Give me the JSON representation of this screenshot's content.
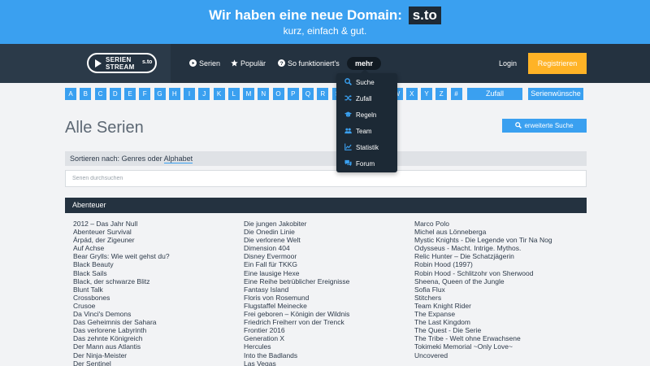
{
  "banner": {
    "main_text": "Wir haben eine neue Domain:",
    "domain": "s.to",
    "subtitle": "kurz, einfach & gut."
  },
  "logo": {
    "line1": "SERIEN",
    "line2": "STREAM",
    "badge": "s.to"
  },
  "nav": {
    "items": [
      {
        "label": "Serien",
        "icon": "play-circle-icon"
      },
      {
        "label": "Populär",
        "icon": "star-icon"
      },
      {
        "label": "So funktioniert's",
        "icon": "question-circle-icon"
      }
    ],
    "mehr_label": "mehr",
    "login_label": "Login",
    "register_label": "Registrieren"
  },
  "dropdown": {
    "items": [
      {
        "label": "Suche",
        "icon": "search-icon"
      },
      {
        "label": "Zufall",
        "icon": "shuffle-icon"
      },
      {
        "label": "Regeln",
        "icon": "graduation-cap-icon"
      },
      {
        "label": "Team",
        "icon": "users-icon"
      },
      {
        "label": "Statistik",
        "icon": "chart-icon"
      },
      {
        "label": "Forum",
        "icon": "comments-icon"
      }
    ]
  },
  "alphabet": [
    "A",
    "B",
    "C",
    "D",
    "E",
    "F",
    "G",
    "H",
    "I",
    "J",
    "K",
    "L",
    "M",
    "N",
    "O",
    "P",
    "Q",
    "R",
    "S",
    "T",
    "U",
    "V",
    "W",
    "X",
    "Y",
    "Z",
    "#"
  ],
  "buttons": {
    "zufall": "Zufall",
    "wuensche": "Serienwünsche",
    "extended_search": "erweiterte Suche"
  },
  "page": {
    "title": "Alle Serien"
  },
  "sort": {
    "prefix": "Sortieren nach:",
    "genres": "Genres",
    "oder": "oder",
    "alphabet": "Alphabet"
  },
  "search": {
    "placeholder": "Serien durchsuchen"
  },
  "genre": {
    "name": "Abenteuer",
    "columns": [
      [
        "2012 – Das Jahr Null",
        "Abenteuer Survival",
        "Árpád, der Zigeuner",
        "Auf Achse",
        "Bear Grylls: Wie weit gehst du?",
        "Black Beauty",
        "Black Sails",
        "Black, der schwarze Blitz",
        "Blunt Talk",
        "Crossbones",
        "Crusoe",
        "Da Vinci's Demons",
        "Das Geheimnis der Sahara",
        "Das verlorene Labyrinth",
        "Das zehnte Königreich",
        "Der Mann aus Atlantis",
        "Der Ninja-Meister",
        "Der Sentinel"
      ],
      [
        "Die jungen Jakobiter",
        "Die Onedin Linie",
        "Die verlorene Welt",
        "Dimension 404",
        "Disney Evermoor",
        "Ein Fall für TKKG",
        "Eine lausige Hexe",
        "Eine Reihe betrüblicher Ereignisse",
        "Fantasy Island",
        "Floris von Rosemund",
        "Flugstaffel Meinecke",
        "Frei geboren – Königin der Wildnis",
        "Friedrich Freiherr von der Trenck",
        "Frontier 2016",
        "Generation X",
        "Hercules",
        "Into the Badlands",
        "Las Vegas"
      ],
      [
        "Marco Polo",
        "Michel aus Lönneberga",
        "Mystic Knights - Die Legende von Tir Na Nog",
        "Odysseus - Macht. Intrige. Mythos.",
        "Relic Hunter – Die Schatzjägerin",
        "Robin Hood (1997)",
        "Robin Hood - Schlitzohr von Sherwood",
        "Sheena, Queen of the Jungle",
        "Sofia Flux",
        "Stitchers",
        "Team Knight Rider",
        "The Expanse",
        "The Last Kingdom",
        "The Quest - Die Serie",
        "The Tribe - Welt ohne Erwachsene",
        "Tokimeki Memorial ~Only Love~",
        "Uncovered"
      ]
    ]
  },
  "colors": {
    "accent": "#3aa0f0",
    "nav_dark": "#243240",
    "register": "#ffb326"
  }
}
